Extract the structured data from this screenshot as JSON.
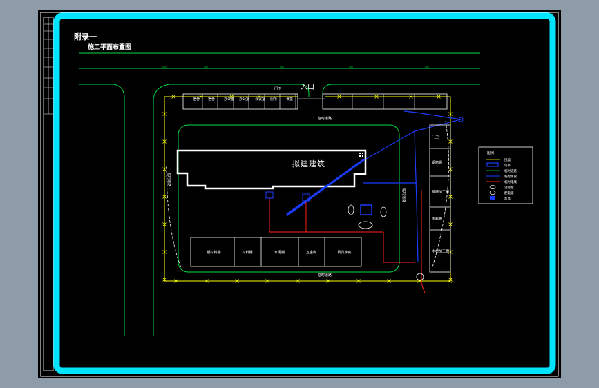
{
  "app": {
    "viewport_background": "#000000",
    "window_background": "#8e9ba8"
  },
  "sheet": {
    "title_line1": "附录一",
    "title_line2": "施工平面布置图",
    "frame_color": "#00e5ff"
  },
  "site": {
    "entrance_label": "入口",
    "building_label": "拟建建筑",
    "top_road_label": "临时道路",
    "bottom_road_label": "临时道路",
    "left_road_label": "临时道路",
    "right_road_label": "临时道路",
    "top_facilities": [
      "宿舍",
      "宿舍",
      "办公室",
      "办公室",
      "会议室",
      "厕所",
      "食堂"
    ],
    "right_facilities": [
      "门卫",
      "钢筋棚",
      "钢筋加工棚",
      "木料棚",
      "木材加工棚"
    ],
    "bottom_sheds": [
      "钢材料棚",
      "材料棚",
      "水泥棚",
      "五金库",
      "机具库房"
    ],
    "top_right_room": "门卫"
  },
  "legend": {
    "title": "图例：",
    "items": [
      "围墙",
      "塔吊",
      "临时道路",
      "临时水管",
      "临时电线",
      "消防栓",
      "配电箱",
      "灯具"
    ]
  },
  "colors": {
    "building": "#ffffff",
    "road": "#00e040",
    "fence": "#ffff00",
    "water": "#1a3cff",
    "power": "#ff2020",
    "text": "#ffffff"
  }
}
